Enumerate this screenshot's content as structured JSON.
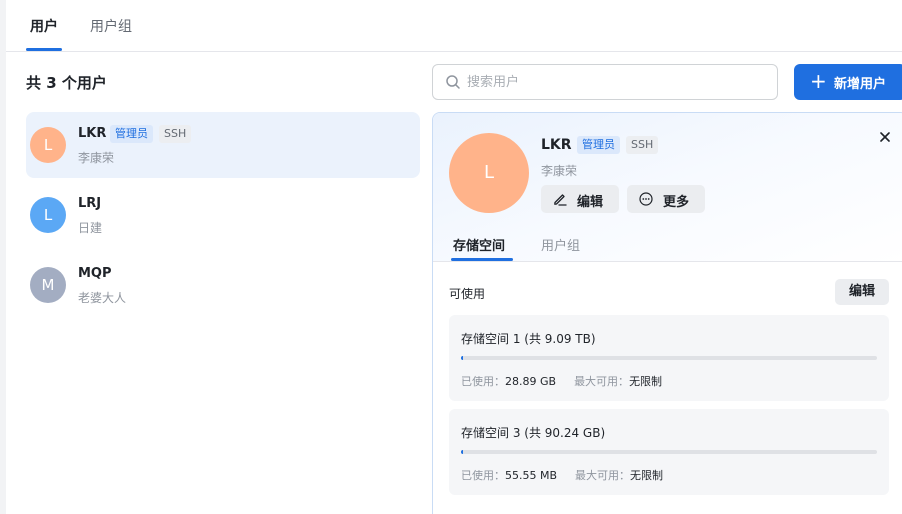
{
  "tabs": [
    {
      "label": "用户",
      "active": true
    },
    {
      "label": "用户组",
      "active": false
    }
  ],
  "user_count_title": "共 3 个用户",
  "search": {
    "placeholder": "搜索用户"
  },
  "add_button_label": "新增用户",
  "users": [
    {
      "initial": "L",
      "name": "LKR",
      "display_name": "李康荣",
      "tags": [
        "管理员",
        "SSH"
      ],
      "avatar_color": "#ffb38a",
      "selected": true
    },
    {
      "initial": "L",
      "name": "LRJ",
      "display_name": "日建",
      "tags": [],
      "avatar_color": "#5ba8f5",
      "selected": false
    },
    {
      "initial": "M",
      "name": "MQP",
      "display_name": "老婆大人",
      "tags": [],
      "avatar_color": "#a3adc2",
      "selected": false
    }
  ],
  "detail": {
    "initial": "L",
    "name": "LKR",
    "display_name": "李康荣",
    "tags": [
      "管理员",
      "SSH"
    ],
    "edit_label": "编辑",
    "more_label": "更多",
    "tabs": [
      {
        "label": "存储空间",
        "active": true
      },
      {
        "label": "用户组",
        "active": false
      }
    ],
    "available_label": "可使用",
    "available_edit_label": "编辑",
    "volumes": [
      {
        "title": "存储空间 1 (共 9.09 TB)",
        "used_label": "已使用：",
        "used": "28.89 GB",
        "max_label": "最大可用：",
        "max": "无限制",
        "usage_fraction": 0.003
      },
      {
        "title": "存储空间 3 (共 90.24 GB)",
        "used_label": "已使用：",
        "used": "55.55 MB",
        "max_label": "最大可用：",
        "max": "无限制",
        "usage_fraction": 0.0006
      }
    ]
  },
  "colors": {
    "accent": "#1f6fe0",
    "admin_tag_bg": "#dbe8fb",
    "selected_row_bg": "#ebf2fc"
  }
}
